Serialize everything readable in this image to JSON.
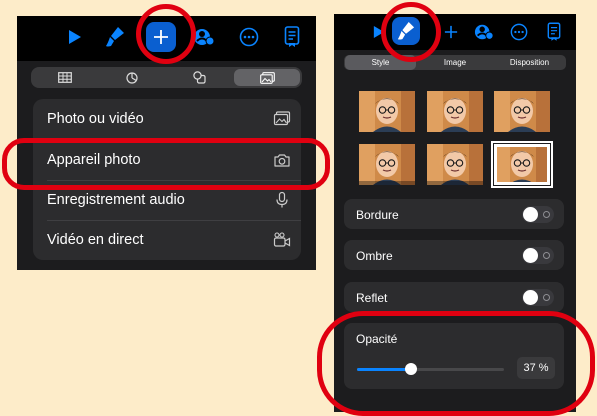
{
  "left_panel": {
    "toolbar_icons": [
      "play-icon",
      "brush-icon",
      "plus-icon",
      "collaborate-icon",
      "more-icon",
      "document-icon"
    ],
    "insert_tabs": [
      "table-icon",
      "chart-icon",
      "shapes-icon",
      "media-icon"
    ],
    "active_tab": "media-icon",
    "menu_items": [
      {
        "label": "Photo ou vidéo",
        "icon": "photo-library-icon"
      },
      {
        "label": "Appareil photo",
        "icon": "camera-icon"
      },
      {
        "label": "Enregistrement audio",
        "icon": "microphone-icon"
      },
      {
        "label": "Vidéo en direct",
        "icon": "live-video-icon"
      }
    ]
  },
  "right_panel": {
    "toolbar_icons": [
      "play-icon",
      "brush-icon",
      "plus-icon",
      "collaborate-icon",
      "more-icon",
      "document-icon"
    ],
    "tabs": [
      "Style",
      "Image",
      "Disposition"
    ],
    "active_tab": "Style",
    "style_presets": [
      {
        "style": "bordered-plain"
      },
      {
        "style": "bordered-plain"
      },
      {
        "style": "bordered-plain"
      },
      {
        "style": "shadow"
      },
      {
        "style": "shadow"
      },
      {
        "style": "framed-white",
        "selected": true
      }
    ],
    "toggles": [
      {
        "label": "Bordure",
        "on": false
      },
      {
        "label": "Ombre",
        "on": false
      },
      {
        "label": "Reflet",
        "on": false
      }
    ],
    "opacity": {
      "label": "Opacité",
      "value": 0.37,
      "display": "37 %"
    }
  },
  "colors": {
    "accent": "#0a84ff",
    "annotation_red": "#e00010",
    "background": "#fdecc9"
  }
}
